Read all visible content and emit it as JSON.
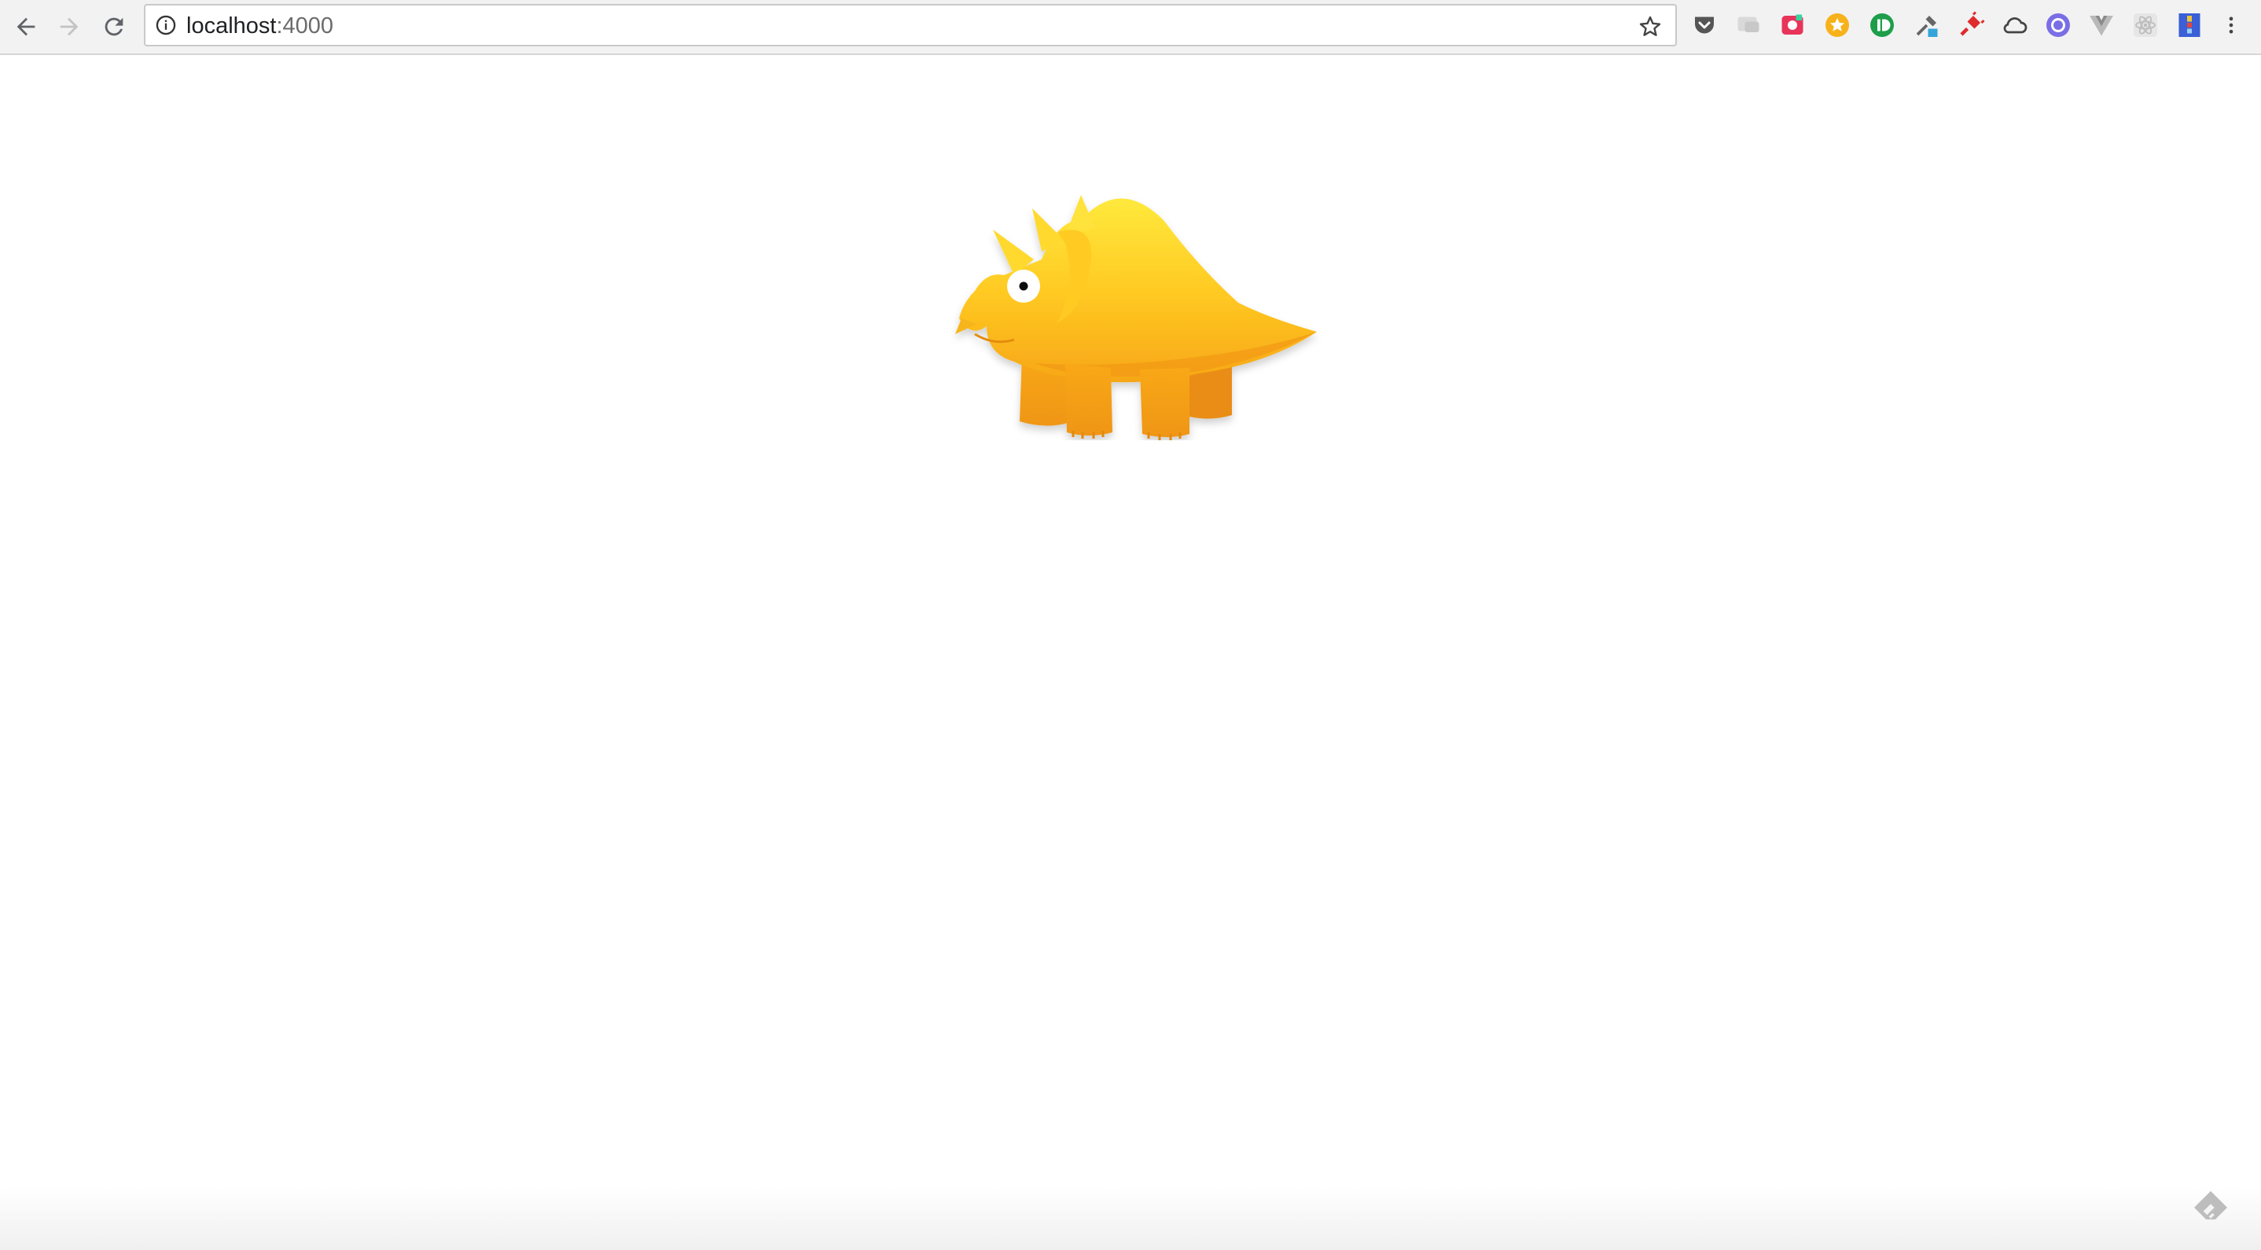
{
  "browser": {
    "url_host": "localhost",
    "url_port": ":4000",
    "back_icon": "arrow-left-icon",
    "forward_icon": "arrow-right-icon",
    "reload_icon": "reload-icon",
    "info_icon": "info-icon",
    "bookmark_icon": "star-outline-icon",
    "menu_icon": "three-dots-vertical-icon",
    "extensions": [
      "pocket-icon",
      "chat-bubble-icon",
      "red-square-icon",
      "orange-star-icon",
      "green-id-icon",
      "eyedropper-icon",
      "red-plug-icon",
      "cloud-icon",
      "purple-circle-icon",
      "vue-icon",
      "react-icon",
      "blue-book-icon"
    ]
  },
  "page": {
    "illustration": "yellow-triceratops-dinosaur",
    "corner_icon": "feedly-icon"
  },
  "colors": {
    "dino_light": "#ffe43a",
    "dino_mid": "#ffc21f",
    "dino_dark": "#f5a316",
    "dino_shadow": "#e98c12"
  }
}
